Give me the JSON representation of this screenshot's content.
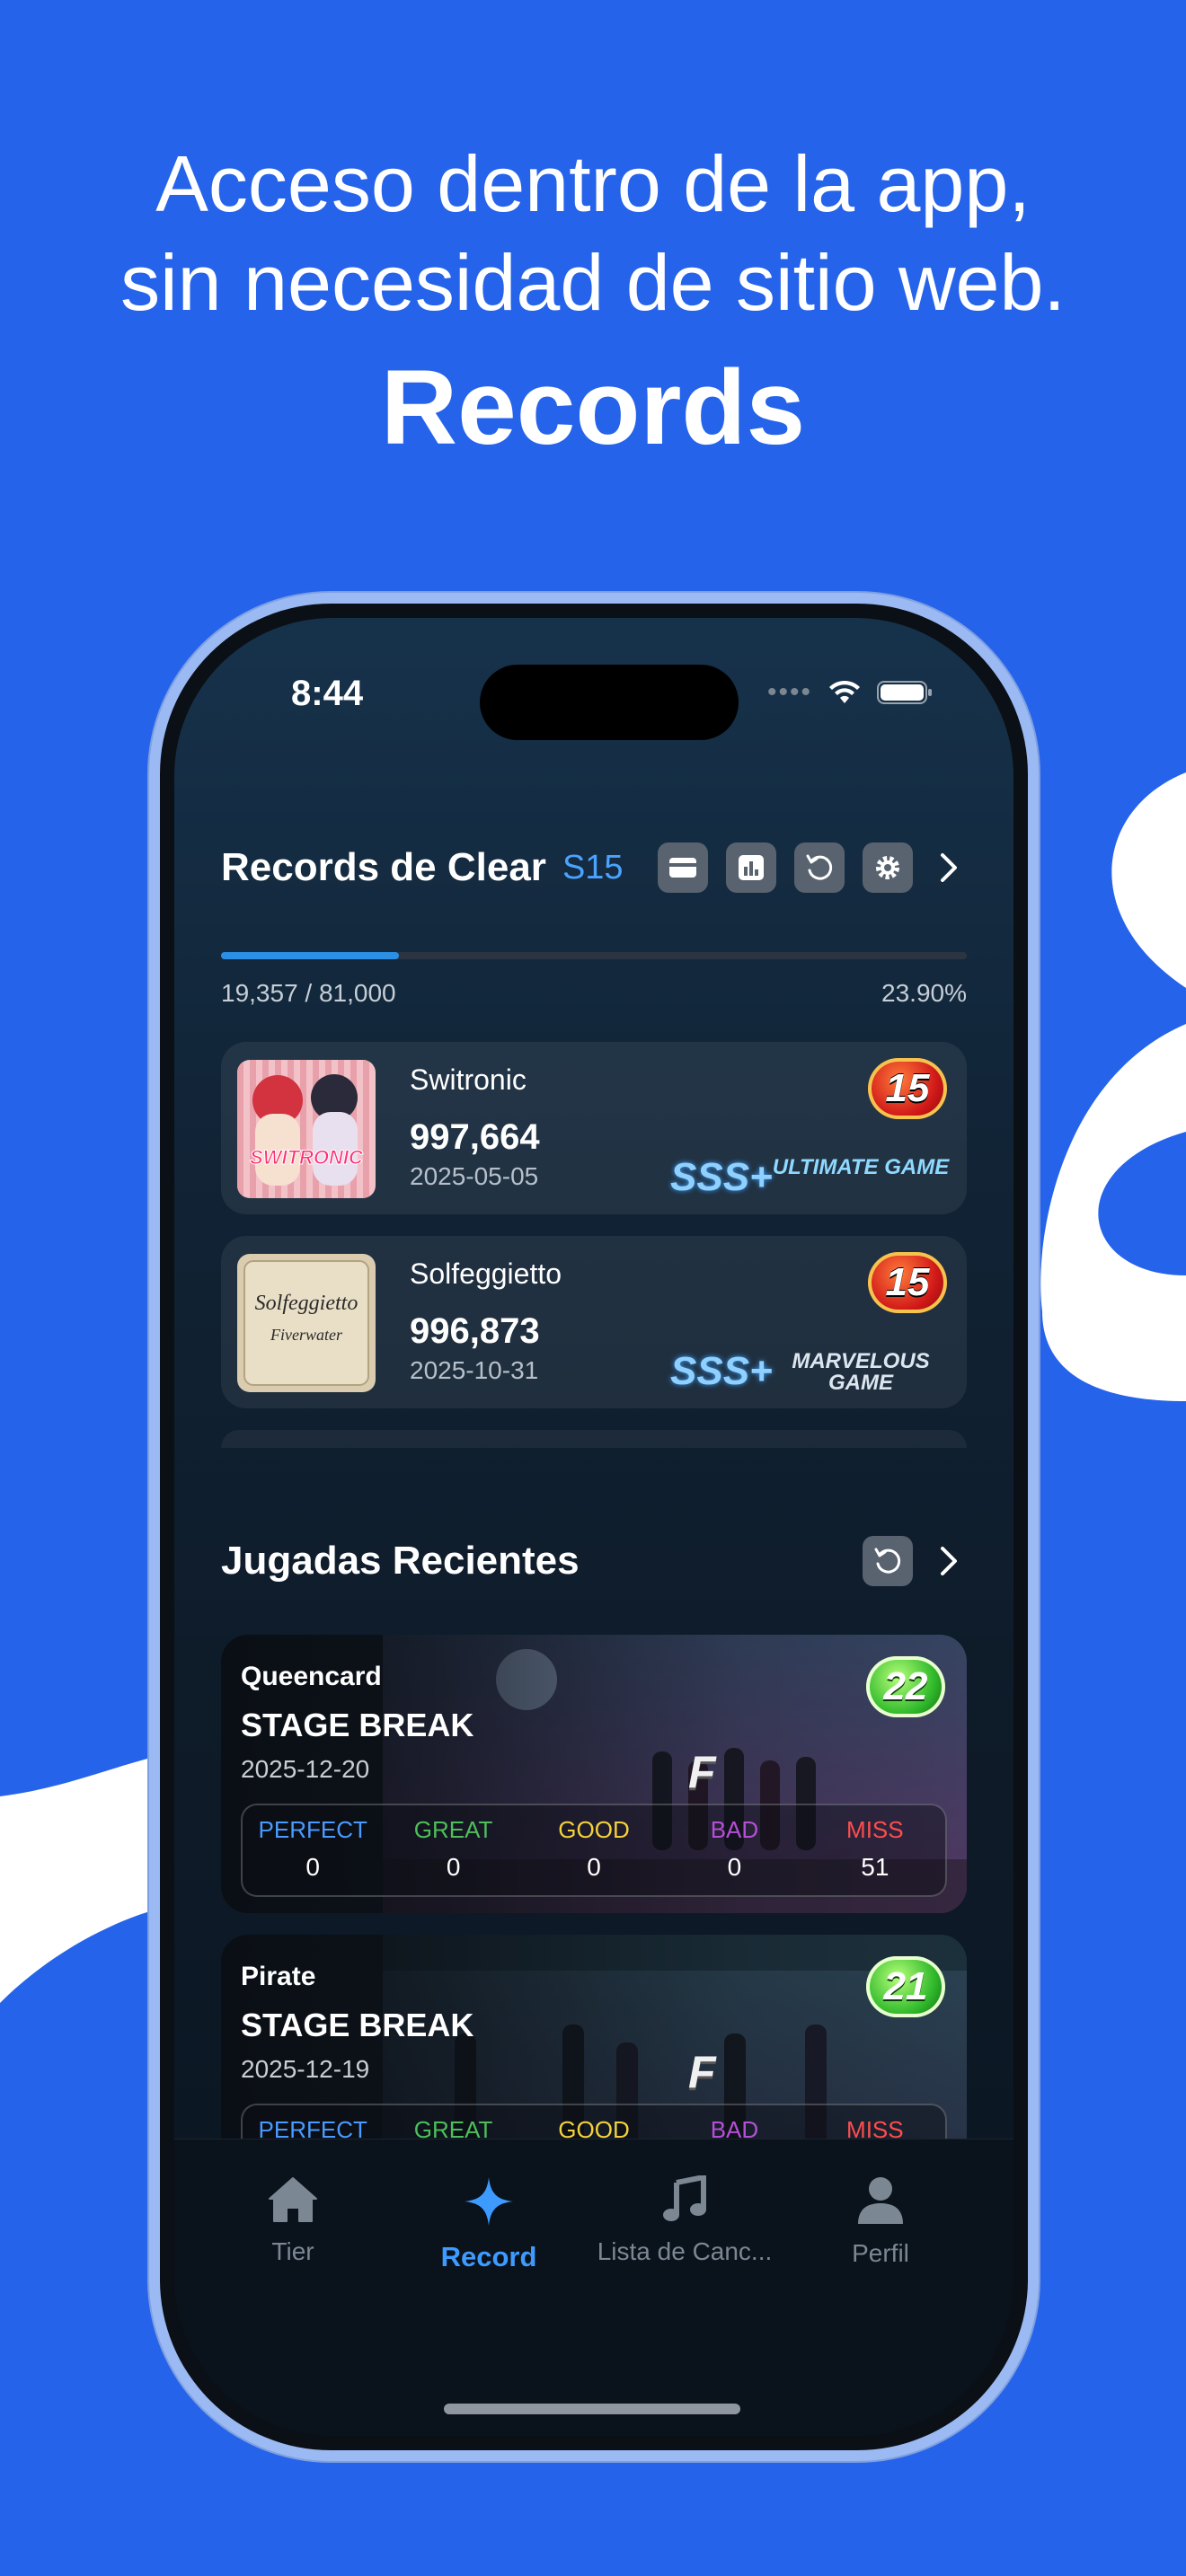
{
  "headline": {
    "line1": "Acceso dentro de la app,",
    "line2": "sin necesidad de sitio web.",
    "line3": "Records"
  },
  "status_bar": {
    "time": "8:44"
  },
  "clear_records": {
    "title": "Records de Clear",
    "season": "S15",
    "progress_text": "19,357 / 81,000",
    "progress_percent": "23.90%",
    "progress_value": 0.239,
    "items": [
      {
        "title": "Switronic",
        "score": "997,664",
        "date": "2025-05-05",
        "level": "15",
        "rank_badge": "SSS+",
        "clear_type": "ULTIMATE GAME",
        "jacket_text": "SWITRONIC"
      },
      {
        "title": "Solfeggietto",
        "score": "996,873",
        "date": "2025-10-31",
        "level": "15",
        "rank_badge": "SSS+",
        "clear_type": "MARVELOUS GAME",
        "jacket_text": "Solfeggietto",
        "jacket_sub": "Fiverwater"
      }
    ]
  },
  "recent_plays": {
    "title": "Jugadas Recientes",
    "judgement_labels": [
      "PERFECT",
      "GREAT",
      "GOOD",
      "BAD",
      "MISS"
    ],
    "items": [
      {
        "song": "Queencard",
        "status": "STAGE BREAK",
        "date": "2025-12-20",
        "level": "22",
        "rank": "F",
        "counts": [
          "0",
          "0",
          "0",
          "0",
          "51"
        ]
      },
      {
        "song": "Pirate",
        "status": "STAGE BREAK",
        "date": "2025-12-19",
        "level": "21",
        "rank": "F",
        "counts": [
          "",
          "",
          "",
          "",
          ""
        ]
      }
    ]
  },
  "tab_bar": {
    "tabs": [
      {
        "label": "Tier",
        "icon": "house-icon"
      },
      {
        "label": "Record",
        "icon": "sparkle-icon",
        "active": true
      },
      {
        "label": "Lista de Canc...",
        "icon": "music-note-icon"
      },
      {
        "label": "Perfil",
        "icon": "person-icon"
      }
    ]
  },
  "colors": {
    "background": "#2563eb",
    "accent": "#3d9bff",
    "perfect": "#4a9bff",
    "great": "#4cbf5a",
    "good": "#f3d23a",
    "bad": "#b54fd6",
    "miss": "#ff4d4d"
  }
}
